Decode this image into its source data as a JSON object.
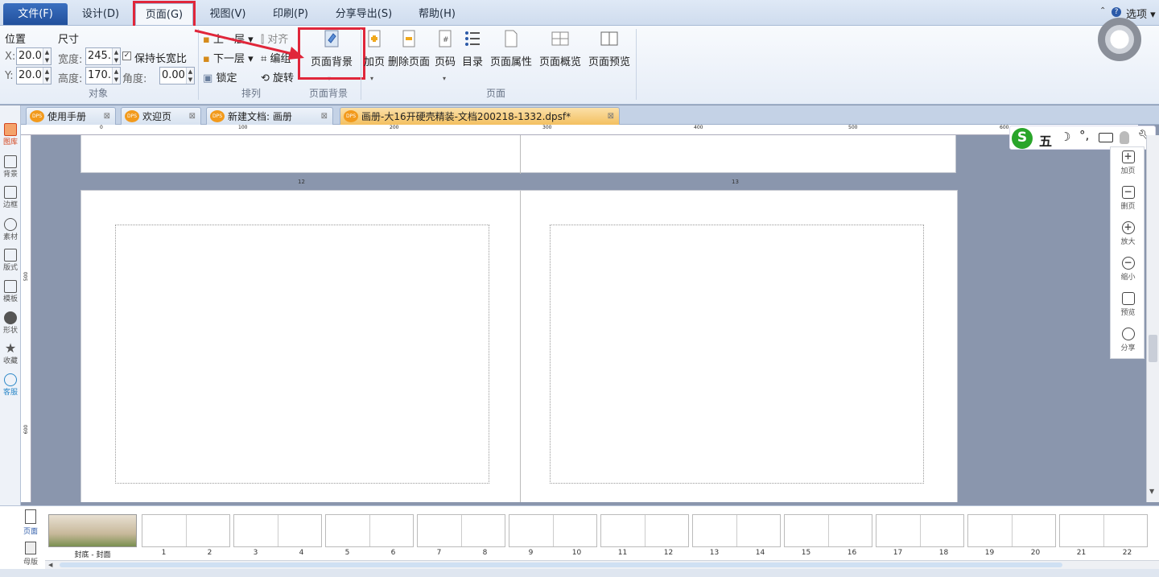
{
  "menubar": {
    "items": [
      "文件(F)",
      "设计(D)",
      "页面(G)",
      "视图(V)",
      "印刷(P)",
      "分享导出(S)",
      "帮助(H)"
    ],
    "options_label": "选项"
  },
  "ribbon": {
    "position_label": "位置",
    "size_label": "尺寸",
    "x_label": "X:",
    "x_value": "20.0(",
    "y_label": "Y:",
    "y_value": "20.0(",
    "width_label": "宽度:",
    "width_value": "245.(",
    "height_label": "高度:",
    "height_value": "170.(",
    "keep_ratio_label": "保持长宽比",
    "angle_label": "角度:",
    "angle_value": "0.00",
    "group_object": "对象",
    "arrange": {
      "bring_forward": "上一层",
      "send_backward": "下一层",
      "lock": "锁定",
      "align": "对齐",
      "group": "编组",
      "rotate": "旋转",
      "group_label": "排列"
    },
    "page_bg": {
      "label": "页面背景",
      "group_label": "页面背景"
    },
    "page_group": {
      "add_page": "加页",
      "delete_page": "删除页面",
      "page_number": "页码",
      "toc": "目录",
      "page_properties": "页面属性",
      "page_overview": "页面概览",
      "page_preview": "页面预览",
      "group_label": "页面"
    }
  },
  "tabs": [
    {
      "label": "使用手册",
      "active": false
    },
    {
      "label": "欢迎页",
      "active": false
    },
    {
      "label": "新建文档: 画册",
      "active": false
    },
    {
      "label": "画册-大16开硬壳精装-文档200218-1332.dpsf*",
      "active": true
    }
  ],
  "sidebar": [
    "图库",
    "背景",
    "边框",
    "素材",
    "版式",
    "模板",
    "形状",
    "收藏",
    "客服"
  ],
  "ruler": {
    "top": [
      "0",
      "100",
      "200",
      "300",
      "400",
      "500",
      "600"
    ],
    "left": [
      "500",
      "600"
    ]
  },
  "canvas": {
    "page_numbers": [
      "12",
      "13"
    ]
  },
  "right_tools": [
    "加页",
    "删页",
    "放大",
    "缩小",
    "预览",
    "分享"
  ],
  "ime": {
    "label": "五"
  },
  "thumbnails": {
    "cover_label": "封底 - 封面",
    "numbers": [
      "1",
      "2",
      "3",
      "4",
      "5",
      "6",
      "7",
      "8",
      "9",
      "10",
      "11",
      "12",
      "13",
      "14",
      "15",
      "16",
      "17",
      "18",
      "19",
      "20",
      "21",
      "22"
    ],
    "left_tabs": [
      "页面",
      "母版"
    ]
  },
  "colors": {
    "accent": "#21509c",
    "highlight": "#e0263a",
    "tab_active": "#f6c36a"
  }
}
